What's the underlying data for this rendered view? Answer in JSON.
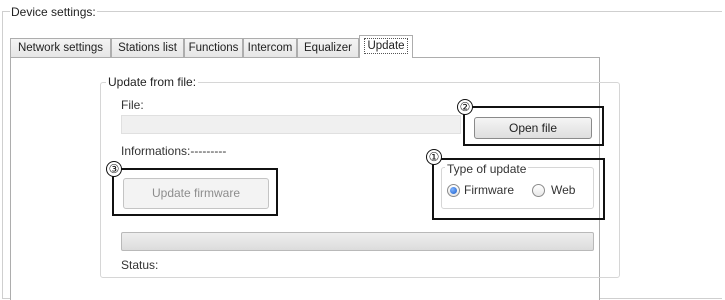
{
  "device_settings": {
    "title": "Device settings:"
  },
  "tabs": [
    {
      "label": "Network settings",
      "active": false
    },
    {
      "label": "Stations list",
      "active": false
    },
    {
      "label": "Functions",
      "active": false
    },
    {
      "label": "Intercom",
      "active": false
    },
    {
      "label": "Equalizer",
      "active": false
    },
    {
      "label": "Update",
      "active": true
    }
  ],
  "update_group": {
    "title": "Update from file:",
    "file_label": "File:",
    "file_value": "",
    "open_file_button": "Open file",
    "informations_label": "Informations:---------",
    "update_firmware_button": "Update firmware",
    "type_of_update": {
      "title": "Type of update",
      "options": [
        {
          "label": "Firmware",
          "checked": true
        },
        {
          "label": "Web",
          "checked": false
        }
      ]
    },
    "progress": 0,
    "status_label": "Status:"
  },
  "callouts": [
    {
      "number": "①"
    },
    {
      "number": "②"
    },
    {
      "number": "③"
    }
  ]
}
